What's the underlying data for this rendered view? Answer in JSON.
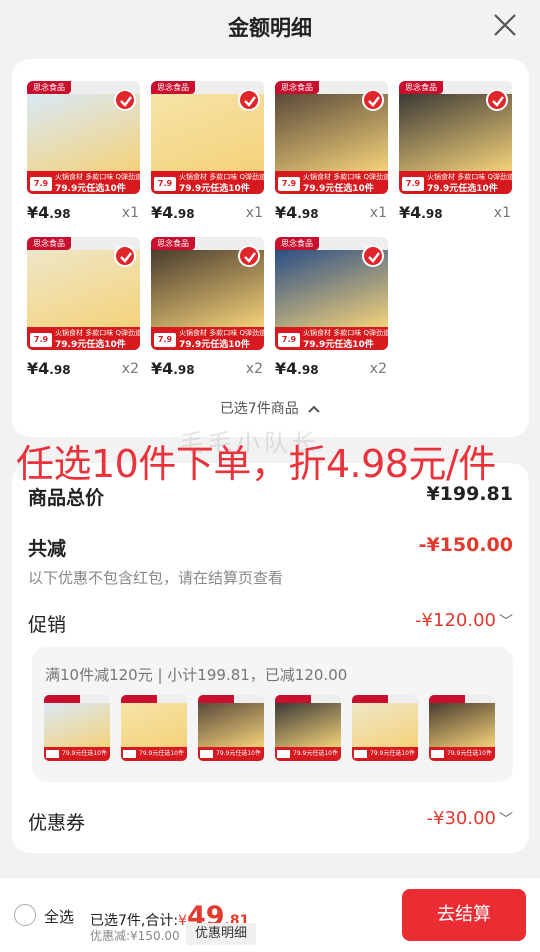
{
  "header": {
    "title": "金额明细"
  },
  "product": {
    "brand": "思念食品",
    "promo_price": "7.9",
    "promo_top": "火锅食材 多款口味 Q弹劲道",
    "promo_bottom": "79.9元任选10件",
    "price_symbol": "¥",
    "price_int": "4",
    "price_dec": ".98"
  },
  "items": [
    {
      "qty": "x1",
      "color": "#d9e9f6"
    },
    {
      "qty": "x1",
      "color": "#f6e4a8"
    },
    {
      "qty": "x1",
      "color": "#5a4a3a"
    },
    {
      "qty": "x1",
      "color": "#3c3a36"
    },
    {
      "qty": "x2",
      "color": "#efe7c8"
    },
    {
      "qty": "x2",
      "color": "#4a3c2e"
    },
    {
      "qty": "x2",
      "color": "#2a4e86"
    }
  ],
  "selected_summary": "已选7件商品",
  "banner": "任选10件下单，折4.98元/件",
  "watermark": "毛毛小队长",
  "breakdown": {
    "total_label": "商品总价",
    "total_value": "¥199.81",
    "discount_label": "共减",
    "discount_value": "-¥150.00",
    "discount_note": "以下优惠不包含红包，请在结算页查看",
    "promo_label": "促销",
    "promo_value": "-¥120.00",
    "promo_detail": "满10件减120元 | 小计199.81，已减120.00",
    "coupon_label": "优惠券",
    "coupon_value": "-¥30.00"
  },
  "footer": {
    "select_all": "全选",
    "summary_prefix": "已选7件,合计:",
    "currency": "¥",
    "total_int": "49",
    "total_dec": ".81",
    "saved": "优惠减:¥150.00",
    "detail_button": "优惠明细",
    "checkout": "去结算"
  },
  "colors": {
    "accent": "#ea2d33",
    "banner": "#e8333c"
  }
}
